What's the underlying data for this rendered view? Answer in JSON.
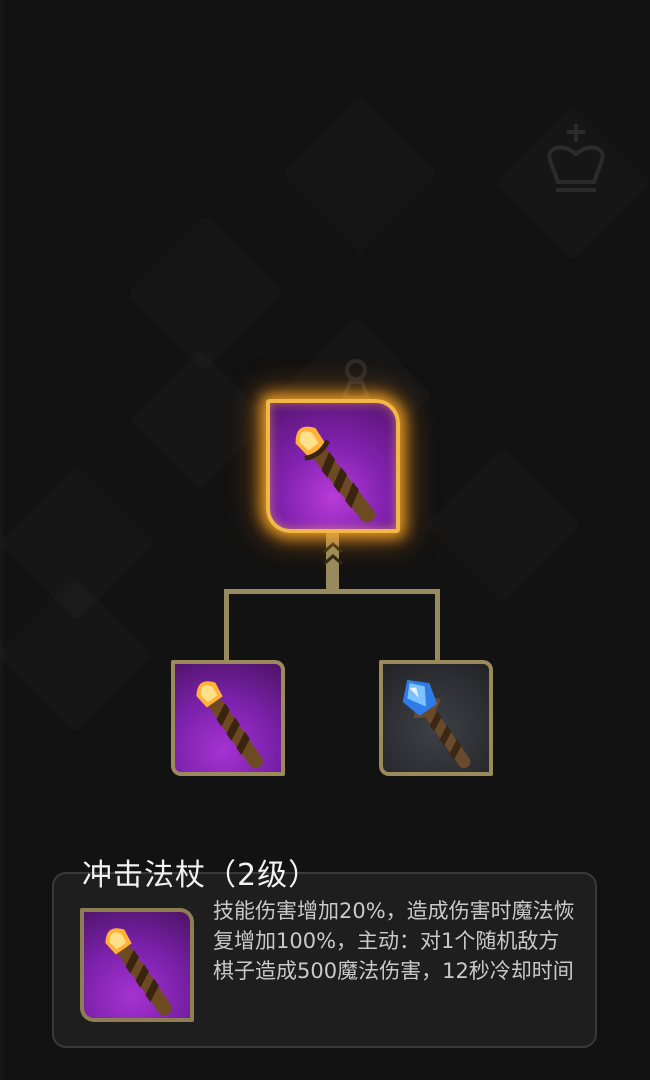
{
  "item_tree": {
    "result_item": {
      "icon": "impact-staff-icon",
      "frame_color": "#f1b848",
      "highlighted": true
    },
    "components": [
      {
        "icon": "twisted-staff-icon",
        "frame_color": "#9a8a5c"
      },
      {
        "icon": "blue-gem-staff-icon",
        "frame_color": "#9a8a5c"
      }
    ],
    "connector_color": "#978a5e"
  },
  "tooltip": {
    "title": "冲击法杖（2级）",
    "icon": "impact-staff-icon",
    "description": "技能伤害增加20%，造成伤害时魔法恢复增加100%，主动：对1个随机敌方棋子造成500魔法伤害，12秒冷却时间"
  },
  "colors": {
    "background": "#121212",
    "panel": "#1e1e1e",
    "panel_border": "#3a3a3a",
    "gold_glow": "#f1b848",
    "purple_rarity": "#8222b0"
  }
}
